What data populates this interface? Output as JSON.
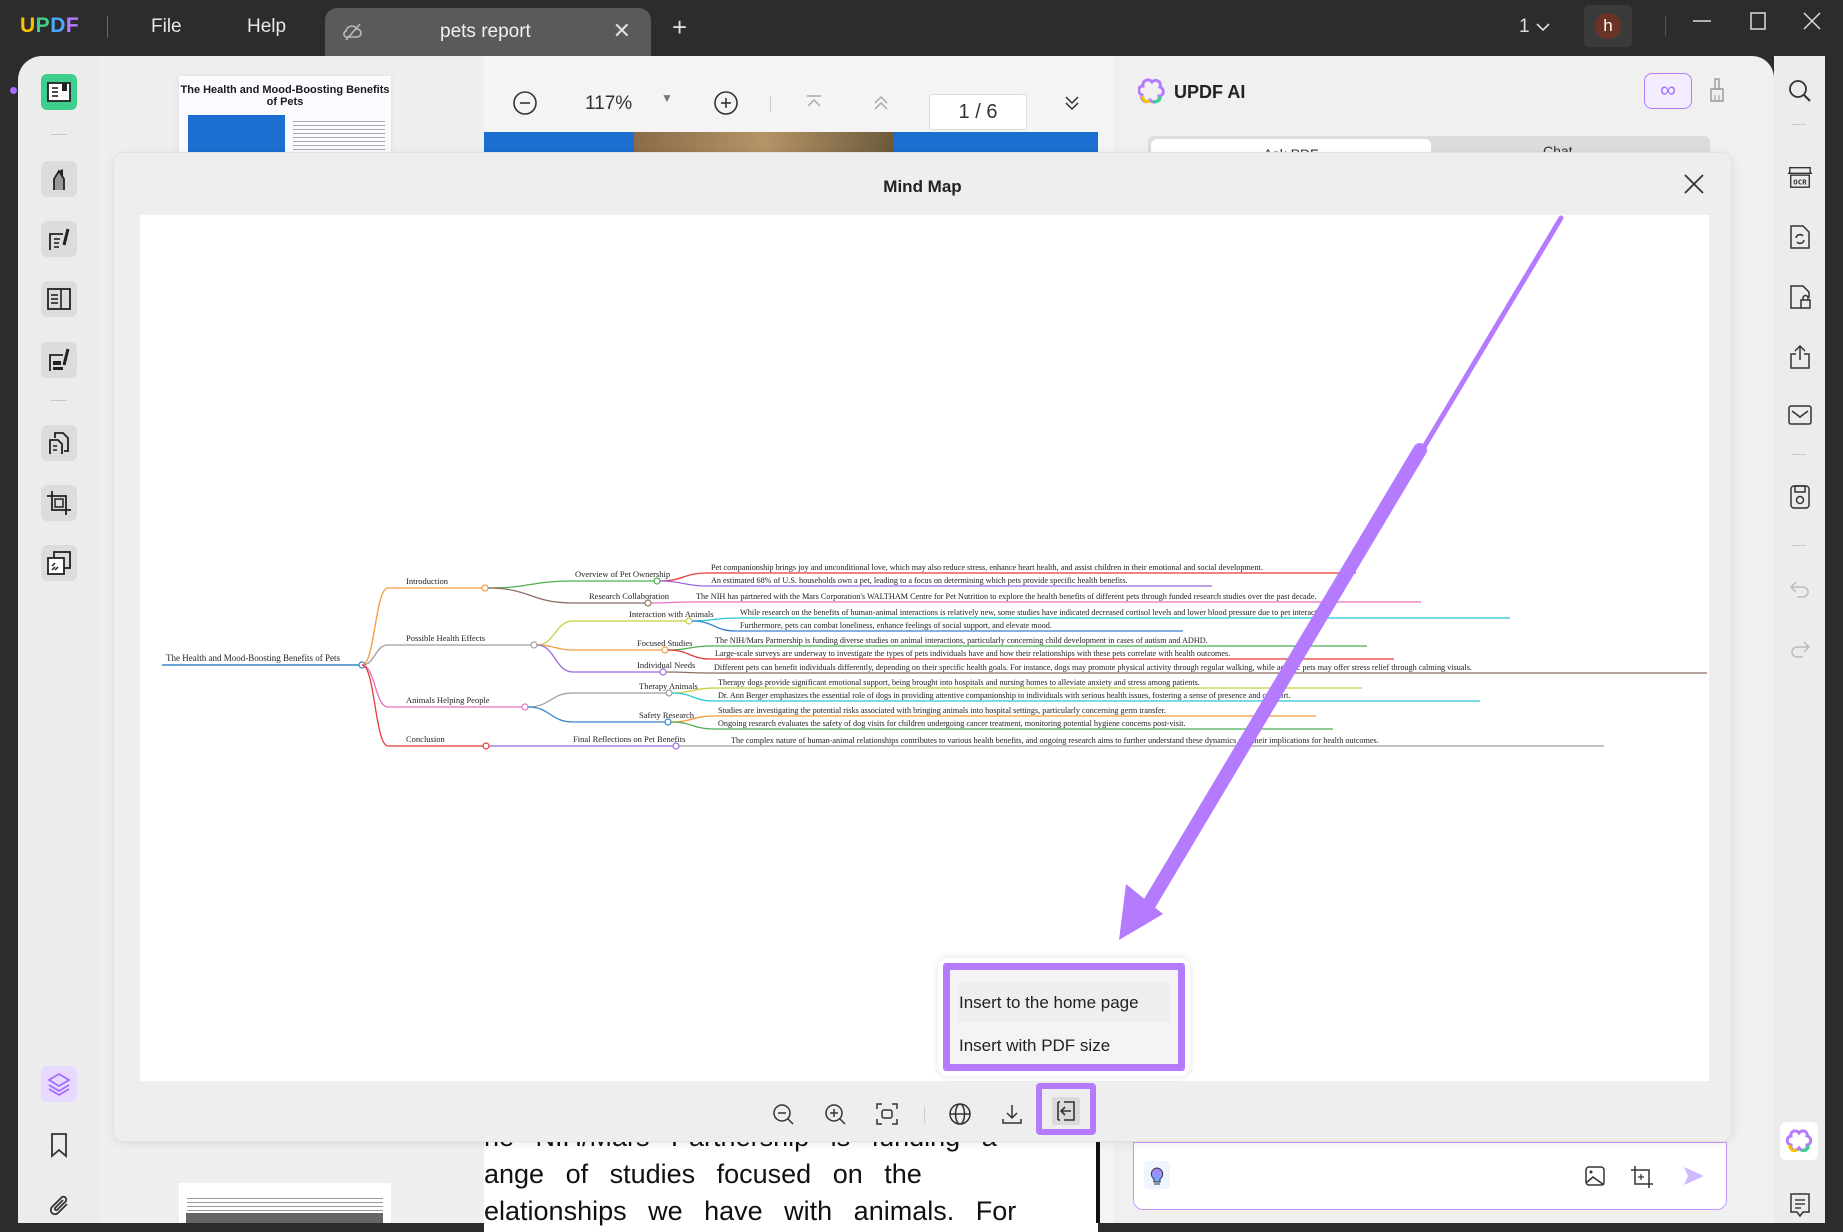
{
  "app": {
    "logo": {
      "u": "U",
      "p": "P",
      "d": "D",
      "f": "F"
    },
    "menu": [
      "File",
      "Help"
    ],
    "tab_title": "pets report",
    "page_indicator": "1",
    "avatar_initial": "h"
  },
  "doc_toolbar": {
    "zoom": "117%",
    "page_current": "1",
    "page_total": "6",
    "page_display": "1 / 6"
  },
  "thumbnail": {
    "title": "The Health and Mood-Boosting Benefits of Pets"
  },
  "doc_text": {
    "line1": "he NIH/Mars Partnership is funding a",
    "line2": "ange of studies focused on the",
    "line3": "elationships we have with animals. For"
  },
  "ai_panel": {
    "title": "UPDF AI",
    "tabs": [
      "Ask PDF",
      "Chat"
    ]
  },
  "modal": {
    "title": "Mind Map",
    "dropdown": [
      "Insert to the home page",
      "Insert with PDF size"
    ]
  },
  "mindmap": {
    "root": "The Health and Mood-Boosting Benefits of Pets",
    "branches": [
      {
        "label": "Introduction",
        "color": "#f39a3d",
        "children": [
          {
            "label": "Overview of Pet Ownership",
            "color": "#4caf50",
            "leaves": [
              {
                "text": "Pet companionship brings joy and unconditional love, which may also reduce stress, enhance heart health, and assist children in their emotional and social development.",
                "color": "#e53935"
              },
              {
                "text": "An estimated 68% of U.S. households own a pet, leading to a focus on determining which pets provide specific health benefits.",
                "color": "#9c6ade"
              }
            ]
          },
          {
            "label": "Research Collaboration",
            "color": "#8d6e63",
            "leaves": [
              {
                "text": "The NIH has partnered with the Mars Corporation's WALTHAM Centre for Pet Nutrition to explore the health benefits of different pets through funded research studies over the past decade.",
                "color": "#ec6fc0"
              }
            ]
          }
        ]
      },
      {
        "label": "Possible Health Effects",
        "color": "#9e9e9e",
        "children": [
          {
            "label": "Interaction with Animals",
            "color": "#c6cf3b",
            "leaves": [
              {
                "text": "While research on the benefits of human-animal interactions is relatively new, some studies have indicated decreased cortisol levels and lower blood pressure due to pet interaction.",
                "color": "#26c6da"
              },
              {
                "text": "Furthermore, pets can combat loneliness, enhance feelings of social support, and elevate mood.",
                "color": "#3a85c9"
              }
            ]
          },
          {
            "label": "Focused Studies",
            "color": "#f39a3d",
            "leaves": [
              {
                "text": "The NIH/Mars Partnership is funding diverse studies on animal interactions, particularly concerning child development in cases of autism and ADHD.",
                "color": "#4caf50"
              },
              {
                "text": "Large-scale surveys are underway to investigate the types of pets individuals have and how their relationships with these pets correlate with health outcomes.",
                "color": "#e53935"
              }
            ]
          },
          {
            "label": "Individual Needs",
            "color": "#9c6ade",
            "leaves": [
              {
                "text": "Different pets can benefit individuals differently, depending on their specific health goals. For instance, dogs may promote physical activity through regular walking, while aquatic pets may offer stress relief through calming visuals.",
                "color": "#8d6e63"
              }
            ]
          }
        ]
      },
      {
        "label": "Animals Helping People",
        "color": "#ec6fc0",
        "children": [
          {
            "label": "Therapy Animals",
            "color": "#9e9e9e",
            "leaves": [
              {
                "text": "Therapy dogs provide significant emotional support, being brought into hospitals and nursing homes to alleviate anxiety and stress among patients.",
                "color": "#c6cf3b"
              },
              {
                "text": "Dr. Ann Berger emphasizes the essential role of dogs in providing attentive companionship to individuals with serious health issues, fostering a sense of presence and comfort.",
                "color": "#26c6da"
              }
            ]
          },
          {
            "label": "Safety Research",
            "color": "#3a85c9",
            "leaves": [
              {
                "text": "Studies are investigating the potential risks associated with bringing animals into hospital settings, particularly concerning germ transfer.",
                "color": "#f39a3d"
              },
              {
                "text": "Ongoing research evaluates the safety of dog visits for children undergoing cancer treatment, monitoring potential hygiene concerns post-visit.",
                "color": "#4caf50"
              }
            ]
          }
        ]
      },
      {
        "label": "Conclusion",
        "color": "#e53935",
        "children": [
          {
            "label": "Final Reflections on Pet Benefits",
            "color": "#9c6ade",
            "leaves": [
              {
                "text": "The complex nature of human-animal relationships contributes to various health benefits, and ongoing research aims to further understand these dynamics and their implications for health outcomes.",
                "color": "#9e9e9e"
              }
            ]
          }
        ]
      }
    ]
  },
  "colors": {
    "accent": "#b57bff",
    "active_tool": "#3ecf8e",
    "root_line": "#3a85c9"
  }
}
